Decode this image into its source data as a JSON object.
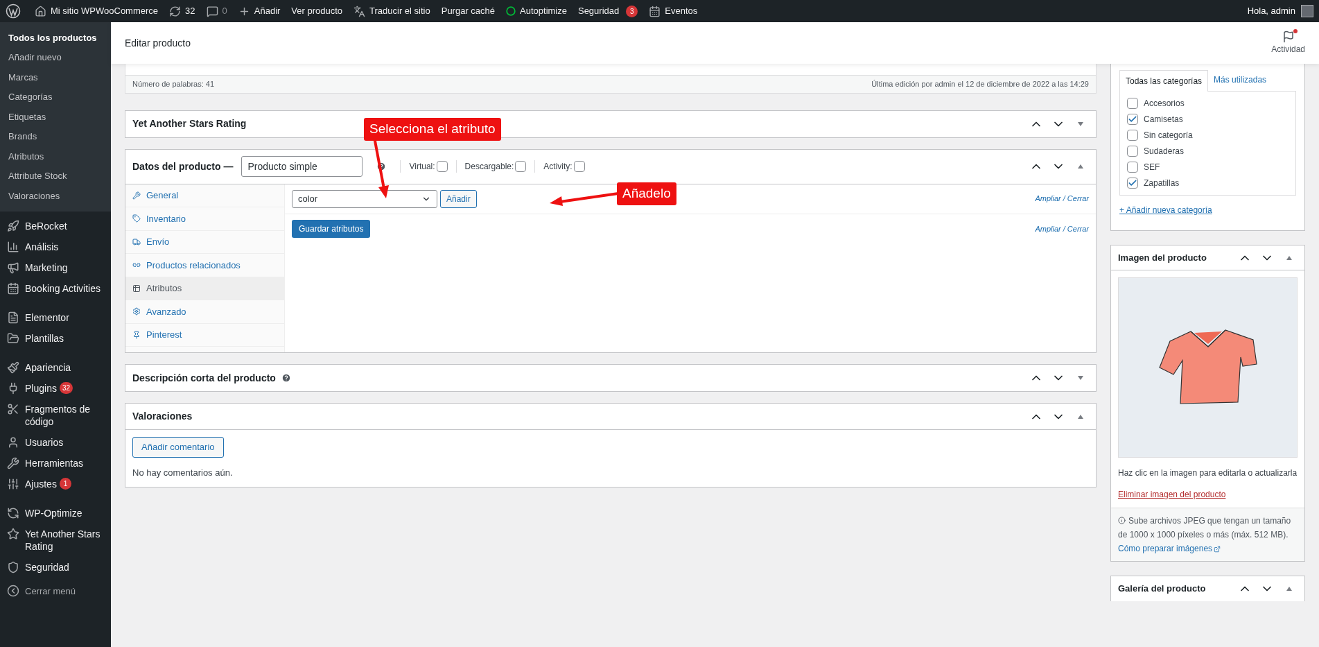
{
  "admin_bar": {
    "items": [
      {
        "label": "Mi sitio WPWooCommerce",
        "muted": false
      },
      {
        "label": "32",
        "muted": false
      },
      {
        "label": "0",
        "muted": true
      },
      {
        "label": "Añadir",
        "muted": false
      },
      {
        "label": "Ver producto",
        "muted": false
      },
      {
        "label": "Traducir el sitio",
        "muted": false
      },
      {
        "label": "Purgar caché",
        "muted": false
      },
      {
        "label": "Autoptimize",
        "muted": false
      },
      {
        "label": "Seguridad",
        "muted": false,
        "badge": "3"
      },
      {
        "label": "Eventos",
        "muted": false
      }
    ],
    "greeting": "Hola, admin"
  },
  "sidebar": {
    "submenu": [
      {
        "label": "Todos los productos",
        "selected": true
      },
      {
        "label": "Añadir nuevo",
        "selected": false
      },
      {
        "label": "Marcas",
        "selected": false
      },
      {
        "label": "Categorías",
        "selected": false
      },
      {
        "label": "Etiquetas",
        "selected": false
      },
      {
        "label": "Brands",
        "selected": false
      },
      {
        "label": "Atributos",
        "selected": false
      },
      {
        "label": "Attribute Stock",
        "selected": false
      },
      {
        "label": "Valoraciones",
        "selected": false
      }
    ],
    "groups": [
      [
        {
          "label": "BeRocket"
        },
        {
          "label": "Análisis"
        },
        {
          "label": "Marketing"
        },
        {
          "label": "Booking Activities"
        }
      ],
      [
        {
          "label": "Elementor"
        },
        {
          "label": "Plantillas"
        }
      ],
      [
        {
          "label": "Apariencia"
        },
        {
          "label": "Plugins",
          "badge": "32"
        },
        {
          "label": "Fragmentos de código"
        },
        {
          "label": "Usuarios"
        },
        {
          "label": "Herramientas"
        },
        {
          "label": "Ajustes",
          "badge": "1"
        }
      ],
      [
        {
          "label": "WP-Optimize"
        },
        {
          "label": "Yet Another Stars Rating"
        },
        {
          "label": "Seguridad"
        }
      ]
    ],
    "collapse": "Cerrar menú"
  },
  "header": {
    "title": "Editar producto",
    "activity": "Actividad"
  },
  "editor_status": {
    "word_count": "Número de palabras: 41",
    "last_edit": "Última edición por admin el 12 de diciembre de 2022 a las 14:29"
  },
  "stars_box": {
    "title": "Yet Another Stars Rating",
    "expanded": false
  },
  "product_data": {
    "title": "Datos del producto —",
    "type": "Producto simple",
    "expanded": true,
    "options": [
      {
        "label": "Virtual:",
        "checked": false
      },
      {
        "label": "Descargable:",
        "checked": false
      },
      {
        "label": "Activity:",
        "checked": false
      }
    ],
    "tabs": [
      {
        "label": "General",
        "selected": false
      },
      {
        "label": "Inventario",
        "selected": false
      },
      {
        "label": "Envío",
        "selected": false
      },
      {
        "label": "Productos relacionados",
        "selected": false
      },
      {
        "label": "Atributos",
        "selected": true
      },
      {
        "label": "Avanzado",
        "selected": false
      },
      {
        "label": "Pinterest",
        "selected": false
      }
    ],
    "attribute": "color",
    "add_button": "Añadir",
    "expand_links": [
      "Ampliar / Cerrar",
      "Ampliar / Cerrar"
    ],
    "save_button": "Guardar atributos"
  },
  "short_description": {
    "title": "Descripción corta del producto",
    "expanded": false
  },
  "reviews": {
    "title": "Valoraciones",
    "expanded": true,
    "button": "Añadir comentario",
    "empty": "No hay comentarios aún."
  },
  "annotations": [
    "Selecciona el atributo",
    "Añadelo"
  ],
  "categories": {
    "tabs": [
      {
        "label": "Todas las categorías",
        "selected": true
      },
      {
        "label": "Más utilizadas",
        "selected": false
      }
    ],
    "items": [
      {
        "label": "Accesorios",
        "checked": false
      },
      {
        "label": "Camisetas",
        "checked": true
      },
      {
        "label": "Sin categoría",
        "checked": false
      },
      {
        "label": "Sudaderas",
        "checked": false
      },
      {
        "label": "SEF",
        "checked": false
      },
      {
        "label": "Zapatillas",
        "checked": true
      }
    ],
    "add_link": "+ Añadir nueva categoría"
  },
  "image_box": {
    "title": "Imagen del producto",
    "expanded": true,
    "hint": "Haz clic en la imagen para editarla o actualizarla",
    "remove": "Eliminar imagen del producto",
    "info": "Sube archivos JPEG que tengan un tamaño de 1000 x 1000 píxeles o más (máx. 512 MB).",
    "info_link": "Cómo preparar imágenes"
  },
  "gallery_box": {
    "title": "Galería del producto",
    "expanded": true
  }
}
